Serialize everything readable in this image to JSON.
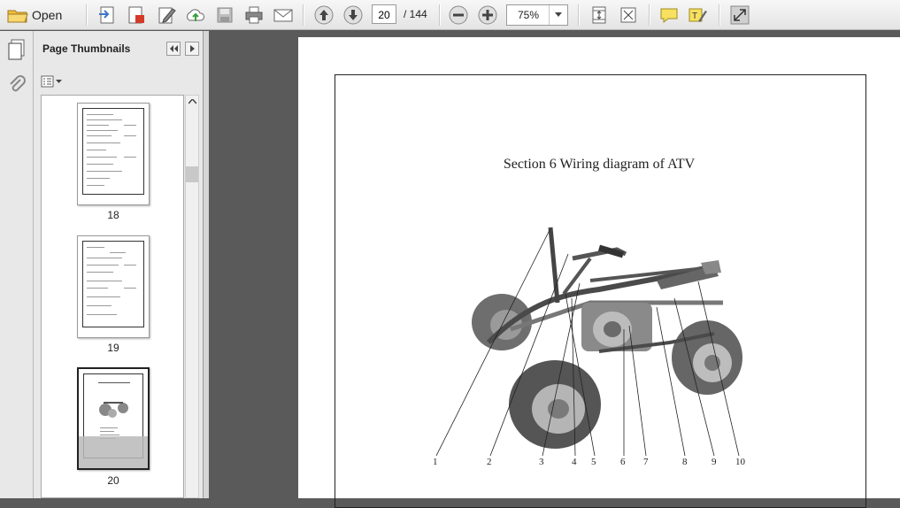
{
  "toolbar": {
    "open_label": "Open",
    "current_page": "20",
    "page_total": "/ 144",
    "zoom": "75%"
  },
  "panel": {
    "title": "Page Thumbnails",
    "thumbnails": [
      {
        "label": "18"
      },
      {
        "label": "19"
      },
      {
        "label": "20"
      }
    ]
  },
  "document": {
    "heading": "Section 6 Wiring diagram of ATV",
    "callouts": [
      "1",
      "2",
      "3",
      "4",
      "5",
      "6",
      "7",
      "8",
      "9",
      "10"
    ]
  },
  "colors": {
    "workspace": "#5a5a5a",
    "toolbar": "#ececec",
    "page": "#ffffff"
  }
}
